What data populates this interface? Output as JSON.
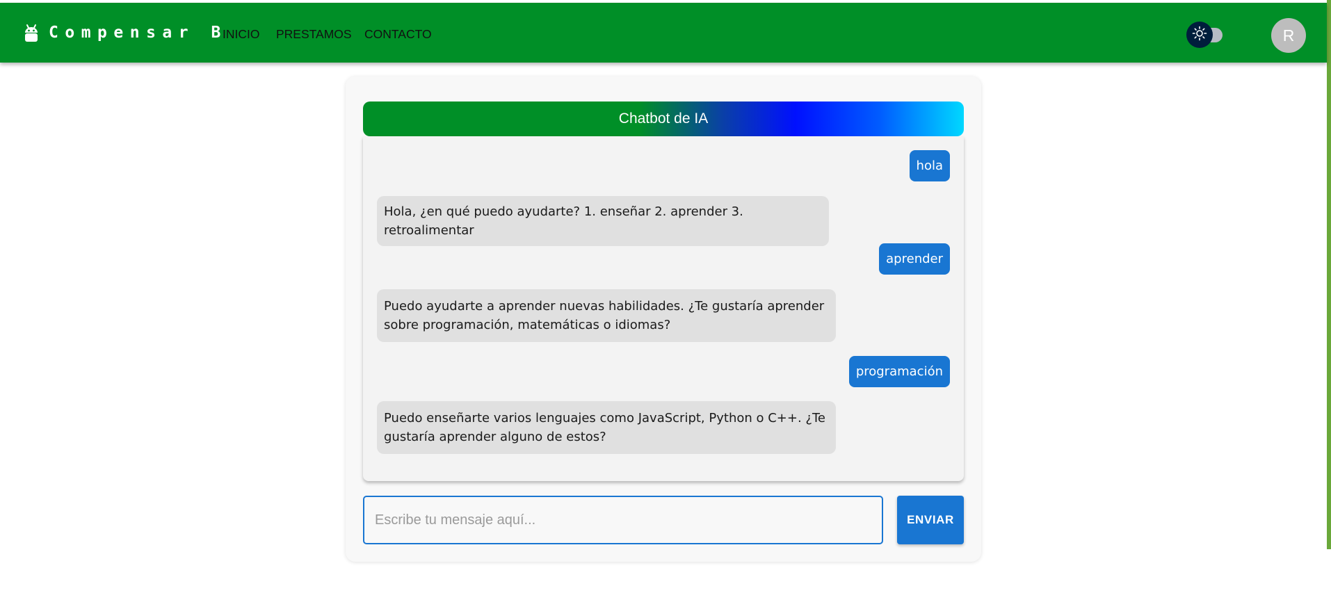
{
  "appbar": {
    "brand_icon": "android-icon",
    "brand": "Compensar B",
    "nav": [
      "INICIO",
      "PRESTAMOS",
      "CONTACTO"
    ],
    "theme_toggle_icon": "sun-icon",
    "avatar_initial": "R"
  },
  "chat": {
    "title": "Chatbot de IA",
    "messages": [
      {
        "from": "user",
        "text": "hola"
      },
      {
        "from": "bot",
        "text": "Hola, ¿en qué puedo ayudarte? 1. enseñar 2. aprender 3. retroalimentar"
      },
      {
        "from": "user",
        "text": "aprender"
      },
      {
        "from": "bot",
        "text": "Puedo ayudarte a aprender nuevas habilidades. ¿Te gustaría aprender sobre programación, matemáticas o idiomas?"
      },
      {
        "from": "user",
        "text": "programación"
      },
      {
        "from": "bot",
        "text": "Puedo enseñarte varios lenguajes como JavaScript, Python o C++. ¿Te gustaría aprender alguno de estos?"
      }
    ],
    "input": {
      "value": "",
      "placeholder": "Escribe tu mensaje aquí..."
    },
    "send_label": "ENVIAR"
  },
  "colors": {
    "appbar": "#008f27",
    "accent": "#1976d2",
    "bot_bubble": "#e0e0e0",
    "chat_bg": "#f3f3f3"
  }
}
